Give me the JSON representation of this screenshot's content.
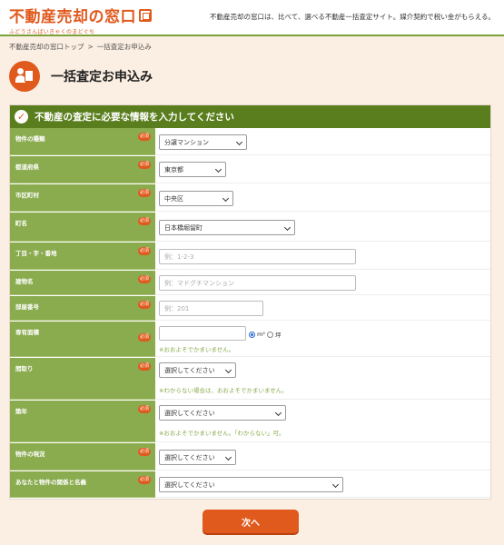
{
  "header": {
    "logo_main": "不動産売却の窓口",
    "logo_sub": "ふどうさんばいきゃくのまどぐち",
    "tagline": "不動産売却の窓口は、比べて、選べる不動産一括査定サイト。媒介契約で税い金がもらえる。"
  },
  "breadcrumb": {
    "home": "不動産売却の窓口トップ",
    "separator": ">",
    "current": "一括査定お申込み"
  },
  "page_title": "一括査定お申込み",
  "form": {
    "header": "不動産の査定に必要な情報を入力してください",
    "required_label": "必須",
    "rows": [
      {
        "label": "物件の種類",
        "value": "分譲マンション"
      },
      {
        "label": "都道府県",
        "value": "東京都"
      },
      {
        "label": "市区町村",
        "value": "中央区"
      },
      {
        "label": "町名",
        "value": "日本橋堀留町"
      },
      {
        "label": "丁目・字・番地",
        "placeholder": "例：1-2-3"
      },
      {
        "label": "建物名",
        "placeholder": "例：マドグチマンション"
      },
      {
        "label": "部屋番号",
        "placeholder": "例：201"
      },
      {
        "label": "専有面積",
        "unit_m2": "m²",
        "unit_tsubo": "坪",
        "note": "※おおよそでかまいません。"
      },
      {
        "label": "間取り",
        "value": "選択してください",
        "note": "※わからない場合は、おおよそでかまいません。"
      },
      {
        "label": "築年",
        "value": "選択してください",
        "note": "※おおよそでかまいません。「わからない」可。"
      },
      {
        "label": "物件の現況",
        "value": "選択してください"
      },
      {
        "label": "あなたと物件の関係と名義",
        "value": "選択してください"
      }
    ]
  },
  "next_button": "次へ",
  "colors": {
    "accent": "#e05a1e",
    "green_dark": "#5a7e1d",
    "green_label": "#8aab4e",
    "background": "#fbeee2"
  }
}
